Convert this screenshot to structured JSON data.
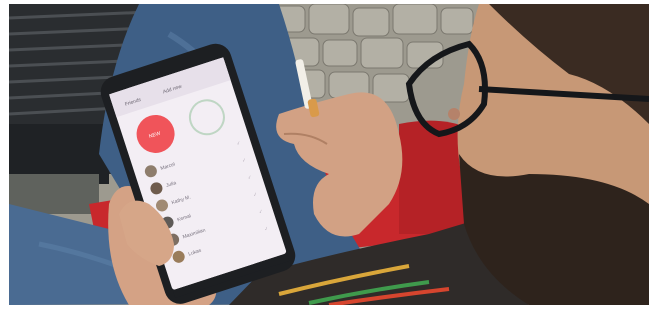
{
  "photo": {
    "scene": "person holding an Android phone showing a contacts app",
    "phone": {
      "app_header": {
        "tab_left_label": "Friends",
        "tab_right_label": "Add new"
      },
      "action_button_label": "NEW",
      "contacts": [
        {
          "name": "Marcel"
        },
        {
          "name": "Julia"
        },
        {
          "name": "Kathy M."
        },
        {
          "name": "Kemal"
        },
        {
          "name": "Maximilian"
        },
        {
          "name": "Lukas"
        }
      ]
    },
    "colors": {
      "accent": "#f0545a",
      "screen_bg": "#f3eef4",
      "phone_body": "#1d1f22",
      "jeans": "#3e5f86",
      "bench": "#c8282c",
      "cobblestone": "#9d9a8f"
    }
  }
}
